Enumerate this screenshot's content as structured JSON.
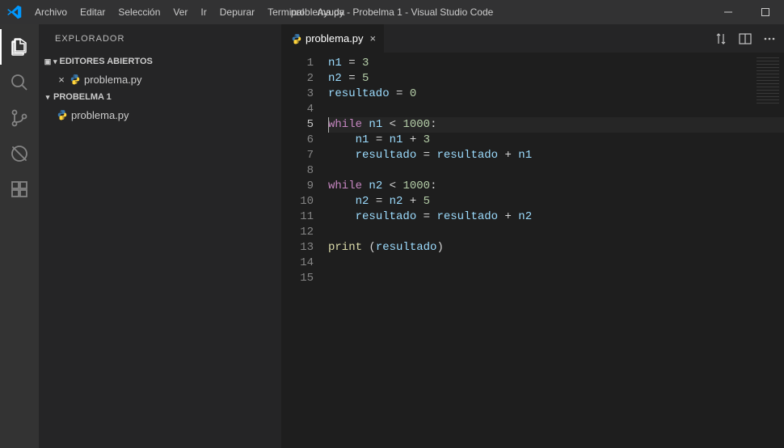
{
  "titlebar": {
    "title": "problema.py - Probelma 1 - Visual Studio Code",
    "menus": [
      "Archivo",
      "Editar",
      "Selección",
      "Ver",
      "Ir",
      "Depurar",
      "Terminal",
      "Ayuda"
    ]
  },
  "sidebar": {
    "panel_title": "EXPLORADOR",
    "open_editors_label": "EDITORES ABIERTOS",
    "open_editors": [
      {
        "name": "problema.py"
      }
    ],
    "folder_label": "PROBELMA 1",
    "files": [
      {
        "name": "problema.py"
      }
    ]
  },
  "tabs": [
    {
      "label": "problema.py",
      "active": true
    }
  ],
  "editor": {
    "current_line": 5,
    "lines": [
      [
        [
          "id",
          "n1"
        ],
        [
          "pl",
          " "
        ],
        [
          "op",
          "="
        ],
        [
          "pl",
          " "
        ],
        [
          "num",
          "3"
        ]
      ],
      [
        [
          "id",
          "n2"
        ],
        [
          "pl",
          " "
        ],
        [
          "op",
          "="
        ],
        [
          "pl",
          " "
        ],
        [
          "num",
          "5"
        ]
      ],
      [
        [
          "id",
          "resultado"
        ],
        [
          "pl",
          " "
        ],
        [
          "op",
          "="
        ],
        [
          "pl",
          " "
        ],
        [
          "num",
          "0"
        ]
      ],
      [],
      [
        [
          "kw",
          "while"
        ],
        [
          "pl",
          " "
        ],
        [
          "id",
          "n1"
        ],
        [
          "pl",
          " "
        ],
        [
          "op",
          "<"
        ],
        [
          "pl",
          " "
        ],
        [
          "num",
          "1000"
        ],
        [
          "pl",
          ":"
        ]
      ],
      [
        [
          "pl",
          "    "
        ],
        [
          "id",
          "n1"
        ],
        [
          "pl",
          " "
        ],
        [
          "op",
          "="
        ],
        [
          "pl",
          " "
        ],
        [
          "id",
          "n1"
        ],
        [
          "pl",
          " "
        ],
        [
          "op",
          "+"
        ],
        [
          "pl",
          " "
        ],
        [
          "num",
          "3"
        ]
      ],
      [
        [
          "pl",
          "    "
        ],
        [
          "id",
          "resultado"
        ],
        [
          "pl",
          " "
        ],
        [
          "op",
          "="
        ],
        [
          "pl",
          " "
        ],
        [
          "id",
          "resultado"
        ],
        [
          "pl",
          " "
        ],
        [
          "op",
          "+"
        ],
        [
          "pl",
          " "
        ],
        [
          "id",
          "n1"
        ]
      ],
      [],
      [
        [
          "kw",
          "while"
        ],
        [
          "pl",
          " "
        ],
        [
          "id",
          "n2"
        ],
        [
          "pl",
          " "
        ],
        [
          "op",
          "<"
        ],
        [
          "pl",
          " "
        ],
        [
          "num",
          "1000"
        ],
        [
          "pl",
          ":"
        ]
      ],
      [
        [
          "pl",
          "    "
        ],
        [
          "id",
          "n2"
        ],
        [
          "pl",
          " "
        ],
        [
          "op",
          "="
        ],
        [
          "pl",
          " "
        ],
        [
          "id",
          "n2"
        ],
        [
          "pl",
          " "
        ],
        [
          "op",
          "+"
        ],
        [
          "pl",
          " "
        ],
        [
          "num",
          "5"
        ]
      ],
      [
        [
          "pl",
          "    "
        ],
        [
          "id",
          "resultado"
        ],
        [
          "pl",
          " "
        ],
        [
          "op",
          "="
        ],
        [
          "pl",
          " "
        ],
        [
          "id",
          "resultado"
        ],
        [
          "pl",
          " "
        ],
        [
          "op",
          "+"
        ],
        [
          "pl",
          " "
        ],
        [
          "id",
          "n2"
        ]
      ],
      [],
      [
        [
          "fn",
          "print"
        ],
        [
          "pl",
          " ("
        ],
        [
          "id",
          "resultado"
        ],
        [
          "pl",
          ")"
        ]
      ],
      [],
      []
    ]
  }
}
